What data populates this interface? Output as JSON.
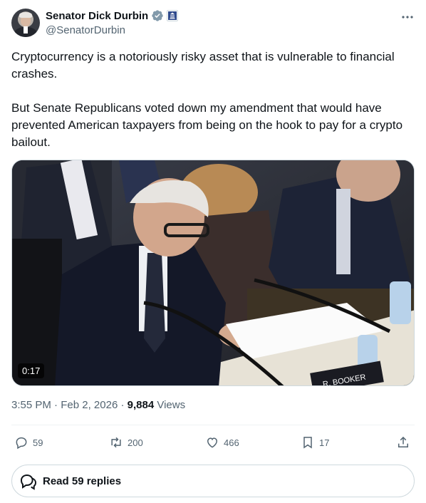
{
  "author": {
    "display_name": "Senator Dick Durbin",
    "handle": "@SenatorDurbin",
    "verified_color": "#829aab"
  },
  "more_icon": "more-horizontal-icon",
  "tweet": {
    "text": "Cryptocurrency is a notoriously risky asset that is vulnerable to financial crashes.\n\nBut Senate Republicans voted down my amendment that would have prevented American taxpayers from being on the hook to pay for a crypto bailout."
  },
  "media": {
    "type": "video",
    "duration": "0:17",
    "nameplate_text": "R. BOOKER"
  },
  "meta": {
    "time": "3:55 PM",
    "separator1": " · ",
    "date": "Feb 2, 2026",
    "separator2": " · ",
    "views_count": "9,884",
    "views_label": " Views"
  },
  "actions": {
    "replies": "59",
    "reposts": "200",
    "likes": "466",
    "bookmarks": "17"
  },
  "read_replies_label": "Read 59 replies",
  "colors": {
    "text_primary": "#0f1419",
    "text_secondary": "#536471",
    "border": "#cfd9de"
  }
}
